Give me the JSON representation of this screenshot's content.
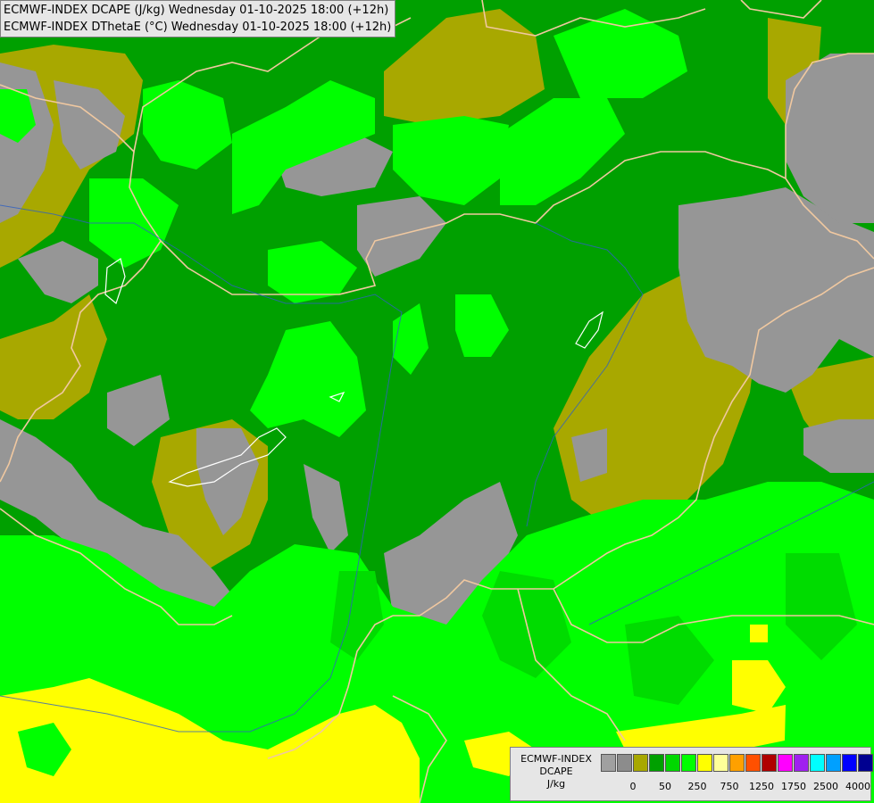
{
  "header": {
    "line1": "ECMWF-INDEX DCAPE (J/kg) Wednesday 01-10-2025 18:00 (+12h)",
    "line2": "ECMWF-INDEX DThetaE (°C) Wednesday 01-10-2025 18:00 (+12h)"
  },
  "legend": {
    "label_lines": [
      "ECMWF-INDEX",
      "DCAPE",
      "J/kg"
    ],
    "colors": [
      "#a0a0a0",
      "#8c8c8c",
      "#a8a800",
      "#00a000",
      "#00d800",
      "#00ff00",
      "#ffff00",
      "#ffff99",
      "#ffa000",
      "#ff5000",
      "#b00000",
      "#ff00ff",
      "#a020f0",
      "#00ffff",
      "#00a0ff",
      "#0000ff",
      "#000090"
    ],
    "tick_labels": [
      "0",
      "50",
      "250",
      "750",
      "1250",
      "1750",
      "2500",
      "4000"
    ]
  },
  "map_colors": {
    "green_dark": "#00a000",
    "green_mid": "#00dc00",
    "green_bright": "#00ff00",
    "olive": "#a8a800",
    "gray": "#969696",
    "yellow": "#ffff00",
    "pale_yellow": "#ffff99",
    "border": "#f0c8a0",
    "river": "#3060c0"
  }
}
